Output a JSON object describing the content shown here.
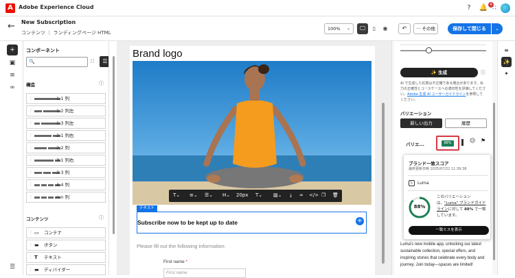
{
  "app": {
    "name": "Adobe Experience Cloud",
    "notification_count": "4"
  },
  "header": {
    "title": "New Subscription",
    "breadcrumb": "コンテンツ ｜ ランディングページ HTML",
    "zoom": "100%",
    "more_label": "その他",
    "save_label": "保存して閉じる"
  },
  "components": {
    "title": "コンポーネント",
    "structure_label": "構造",
    "structure": [
      {
        "label": "1:1 列"
      },
      {
        "label": "1:2 列左"
      },
      {
        "label": "1:3 列左"
      },
      {
        "label": "2:1 列右"
      },
      {
        "label": "2:2 列"
      },
      {
        "label": "3:1 列右"
      },
      {
        "label": "3:3 列"
      },
      {
        "label": "4:4 列"
      },
      {
        "label": "n:n 列"
      }
    ],
    "content_label": "コンテンツ",
    "content": [
      {
        "label": "コンテナ",
        "icon": "container-icon"
      },
      {
        "label": "ボタン",
        "icon": "button-icon"
      },
      {
        "label": "テキスト",
        "icon": "text-icon"
      },
      {
        "label": "ディバイダー",
        "icon": "divider-icon"
      }
    ]
  },
  "canvas": {
    "brand": "Brand logo",
    "tag": "テキスト",
    "headline": "Subscribe now to be kept up to date",
    "subtext": "Please fill out the following information:",
    "first_name_label": "First name",
    "first_name_required": "*",
    "first_name_placeholder": "First name",
    "toolbar": {
      "font_size": "20px"
    }
  },
  "right_panel": {
    "generate_label": "生成",
    "disclaimer": "AI で生成した応答は不正確である場合があります。出力の正確性とユースケースへの適切性を評価してください。",
    "disclaimer_link": "Adobe 生成 AI ユーザーガイドライン",
    "disclaimer_end": "を参照してください。",
    "variations_label": "バリエーション",
    "tab_new": "新しい出力",
    "tab_history": "履歴",
    "variation_name": "バリエ...",
    "score_badge": "88%",
    "popover": {
      "title": "ブランド一致スコア",
      "date": "最終更新日時 2025/07/22 11:39:38",
      "brand": "Luma",
      "score": "88%",
      "text_1": "このバリエーションは、",
      "text_link": "\"Luma\" ブランドガイドライン",
      "text_2": "に対して",
      "text_score": "88%",
      "text_3": "で一致しています。",
      "button": "一致ミスを表示"
    },
    "body_copy": "Luma's new mobile app, unlocking our latest sustainable collection, special offers, and inspiring stories that celebrate every body and journey. Join today—spaces are limited!"
  }
}
